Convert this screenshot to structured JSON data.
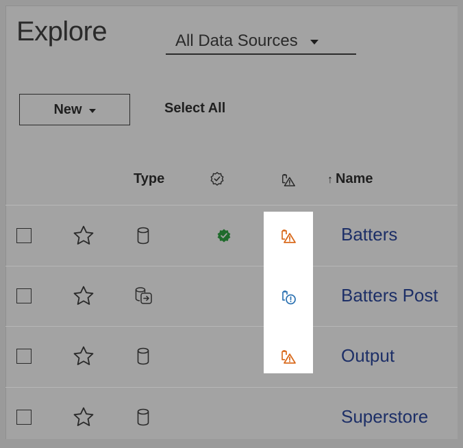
{
  "header": {
    "title": "Explore",
    "data_source_filter": "All Data Sources"
  },
  "toolbar": {
    "new_label": "New",
    "select_all_label": "Select All"
  },
  "columns": {
    "type": "Type",
    "name": "Name",
    "sort_indicator": "↑"
  },
  "rows": [
    {
      "name": "Batters",
      "type_icon": "database-icon",
      "certified": true,
      "quality_icon": "data-quality-warning-icon"
    },
    {
      "name": "Batters Post",
      "type_icon": "virtual-connection-icon",
      "certified": false,
      "quality_icon": "data-quality-info-icon"
    },
    {
      "name": "Output",
      "type_icon": "database-icon",
      "certified": false,
      "quality_icon": "data-quality-warning-icon"
    },
    {
      "name": "Superstore",
      "type_icon": "database-icon",
      "certified": false,
      "quality_icon": null
    }
  ],
  "colors": {
    "background": "#a3a3a3",
    "link": "#1d2f67",
    "certified_green": "#1f6b2c",
    "warning_orange": "#d96a1c",
    "info_blue": "#2f74b3",
    "highlight": "#ffffff"
  }
}
